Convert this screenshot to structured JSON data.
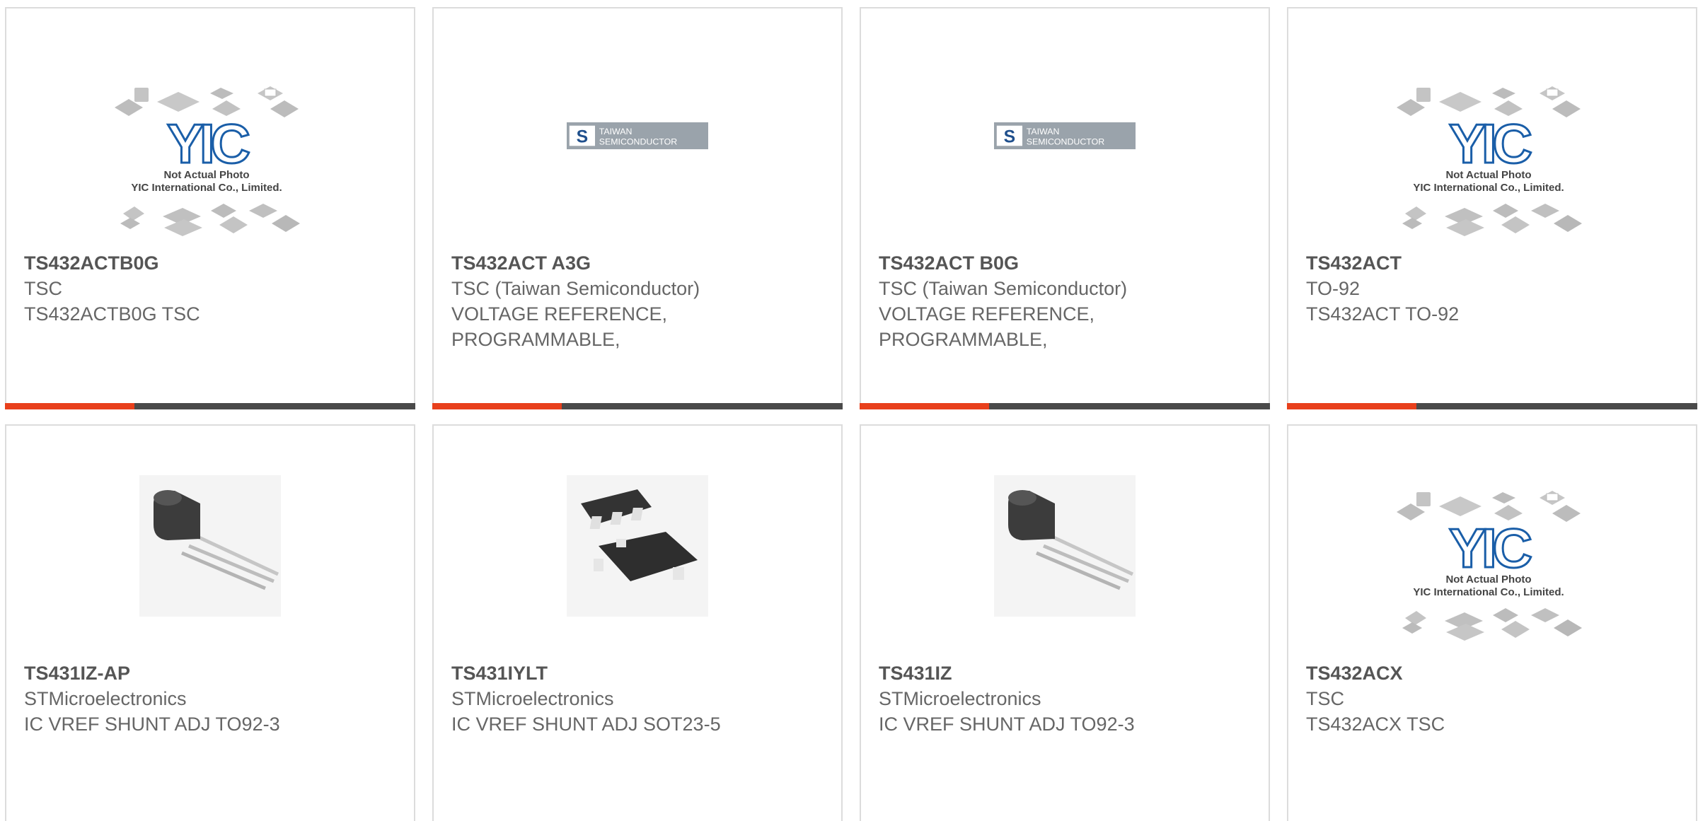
{
  "colors": {
    "accent": "#e8401c",
    "bar": "#4a4a4a",
    "border": "#dcdcdc",
    "text": "#666666",
    "yic_blue": "#1a5ea8",
    "tsc_blue": "#1f4f8c"
  },
  "products": [
    {
      "part": "TS432ACTB0G",
      "manufacturer": "TSC",
      "description": "TS432ACTB0G TSC",
      "image": "yic-placeholder-icon",
      "image_caption": [
        "Not Actual Photo",
        "YIC International Co., Limited."
      ]
    },
    {
      "part": "TS432ACT A3G",
      "manufacturer": "TSC (Taiwan Semiconductor)",
      "description": "VOLTAGE REFERENCE,\nPROGRAMMABLE,",
      "image": "taiwan-semiconductor-logo",
      "image_caption": [
        "TAIWAN",
        "SEMICONDUCTOR"
      ]
    },
    {
      "part": "TS432ACT B0G",
      "manufacturer": "TSC (Taiwan Semiconductor)",
      "description": "VOLTAGE REFERENCE,\nPROGRAMMABLE,",
      "image": "taiwan-semiconductor-logo",
      "image_caption": [
        "TAIWAN",
        "SEMICONDUCTOR"
      ]
    },
    {
      "part": "TS432ACT",
      "manufacturer": "TO-92",
      "description": "TS432ACT TO-92",
      "image": "yic-placeholder-icon",
      "image_caption": [
        "Not Actual Photo",
        "YIC International Co., Limited."
      ]
    },
    {
      "part": "TS431IZ-AP",
      "manufacturer": "STMicroelectronics",
      "description": "IC VREF SHUNT ADJ TO92-3",
      "image": "to92-transistor-icon"
    },
    {
      "part": "TS431IYLT",
      "manufacturer": "STMicroelectronics",
      "description": "IC VREF SHUNT ADJ SOT23-5",
      "image": "sot23-chip-icon"
    },
    {
      "part": "TS431IZ",
      "manufacturer": "STMicroelectronics",
      "description": "IC VREF SHUNT ADJ TO92-3",
      "image": "to92-transistor-icon"
    },
    {
      "part": "TS432ACX",
      "manufacturer": "TSC",
      "description": "TS432ACX TSC",
      "image": "yic-placeholder-icon",
      "image_caption": [
        "Not Actual Photo",
        "YIC International Co., Limited."
      ]
    }
  ]
}
